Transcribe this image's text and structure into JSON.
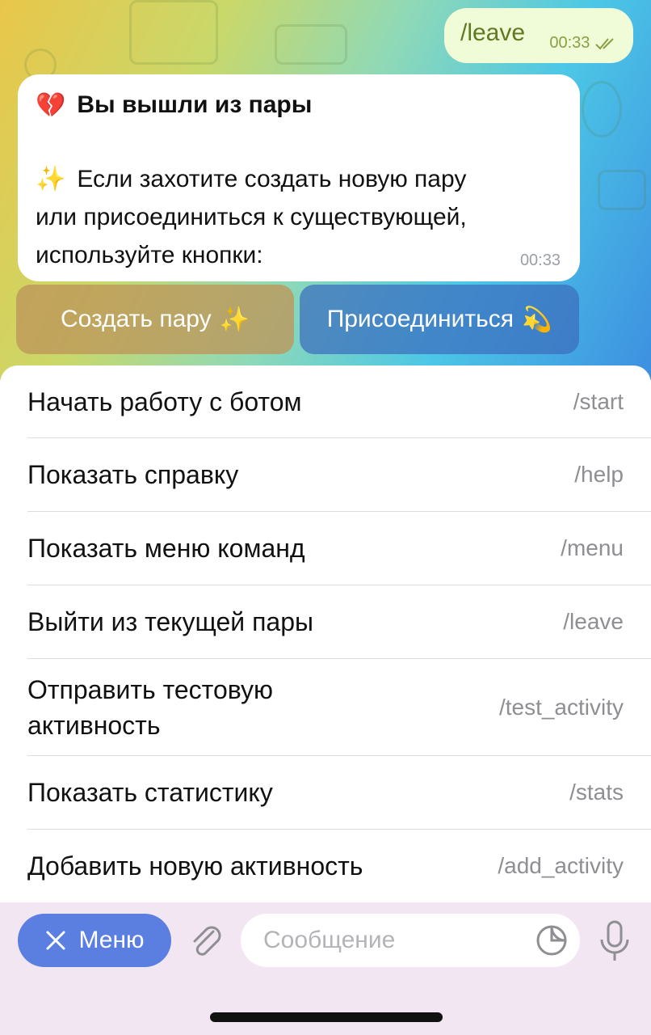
{
  "chat": {
    "outgoing": {
      "text": "/leave",
      "time": "00:33",
      "status_icon": "double-check-icon"
    },
    "incoming": {
      "title": "Вы вышли из пары",
      "title_emoji": "💔",
      "body_emoji": "✨",
      "body_line1": "Если захотите создать новую пару",
      "body_line2": "или присоединиться к существующей,",
      "body_line3": "используйте кнопки:",
      "time": "00:33"
    },
    "inline_buttons": [
      {
        "label": "Создать пару",
        "emoji": "✨"
      },
      {
        "label": "Присоединиться",
        "emoji": "💫"
      }
    ]
  },
  "commands": [
    {
      "desc": "Начать работу с ботом",
      "code": "/start"
    },
    {
      "desc": "Показать справку",
      "code": "/help"
    },
    {
      "desc": "Показать меню команд",
      "code": "/menu"
    },
    {
      "desc": "Выйти из текущей пары",
      "code": "/leave"
    },
    {
      "desc_line1": "Отправить тестовую",
      "desc_line2": "активность",
      "code": "/test_activity"
    },
    {
      "desc": "Показать статистику",
      "code": "/stats"
    },
    {
      "desc": "Добавить новую активность",
      "code": "/add_activity"
    }
  ],
  "input_bar": {
    "menu_label": "Меню",
    "menu_icon": "close-icon",
    "placeholder": "Сообщение",
    "attach_icon": "paperclip-icon",
    "sticker_icon": "sticker-icon",
    "mic_icon": "microphone-icon"
  },
  "colors": {
    "accent": "#5b7fe0",
    "outgoing_bubble": "#f0fbd8"
  }
}
